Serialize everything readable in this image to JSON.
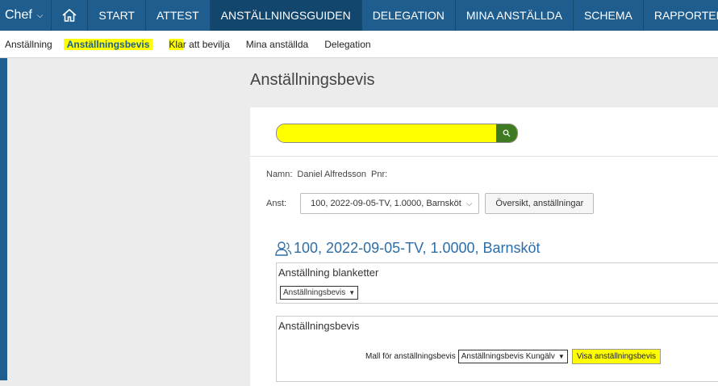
{
  "topnav": {
    "role": "Chef",
    "items": [
      "START",
      "ATTEST",
      "ANSTÄLLNINGSGUIDEN",
      "DELEGATION",
      "MINA ANSTÄLLDA",
      "SCHEMA",
      "RAPPORTER"
    ],
    "active_index": 2
  },
  "subnav": {
    "items": [
      "Anställning",
      "Anställningsbevis",
      "Klar att bevilja",
      "Mina anställda",
      "Delegation"
    ],
    "selected_index": 1
  },
  "page": {
    "title": "Anställningsbevis"
  },
  "search": {
    "value": "",
    "placeholder": ""
  },
  "person": {
    "name_label": "Namn:",
    "name": "Daniel Alfredsson",
    "pnr_label": "Pnr:"
  },
  "anst": {
    "label": "Anst:",
    "selected": "100, 2022-09-05-TV, 1.0000, Barnsköt",
    "overview_button": "Översikt, anställningar"
  },
  "employment": {
    "title": "100, 2022-09-05-TV, 1.0000, Barnsköt"
  },
  "forms_box": {
    "title": "Anställning blanketter",
    "selected": "Anställningsbevis"
  },
  "bevis_box": {
    "title": "Anställningsbevis",
    "template_label": "Mall för anställningsbevis",
    "template_selected": "Anställningsbevis Kungälv",
    "show_button": "Visa anställningsbevis"
  },
  "colors": {
    "nav_bg": "#1e5d8e",
    "nav_active": "#12466d",
    "highlight": "#ffff00",
    "search_button": "#3d7a22",
    "link_blue": "#2d6ea8"
  }
}
